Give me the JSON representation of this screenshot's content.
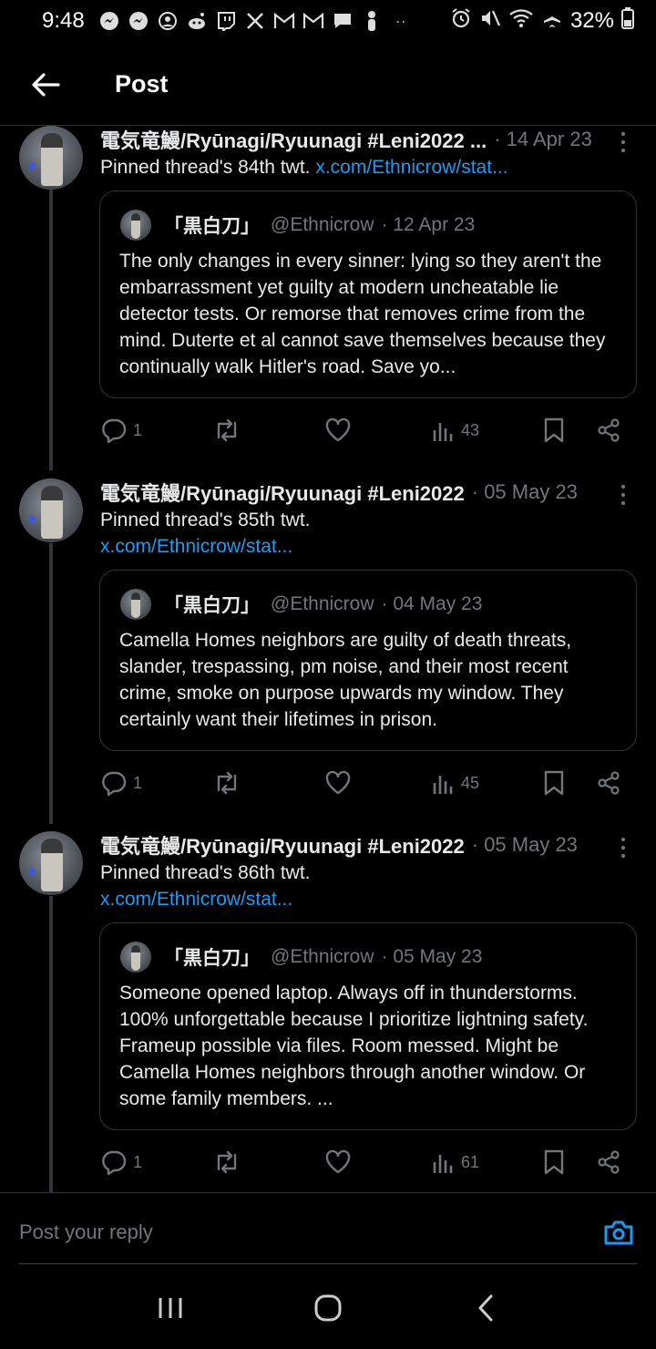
{
  "status_bar": {
    "time": "9:48",
    "battery": "32%",
    "left_icons": [
      "messenger-icon",
      "messenger-icon",
      "account-icon",
      "reddit-icon",
      "twitch-icon",
      "x-icon",
      "gmail-icon",
      "gmail-icon",
      "chat-icon",
      "person-icon",
      "more-dots-icon"
    ],
    "right_icons": [
      "alarm-icon",
      "mute-icon",
      "wifi-icon",
      "airplane-icon",
      "battery-icon"
    ]
  },
  "header": {
    "title": "Post"
  },
  "tweets": [
    {
      "name": "電気竜鰻/Ryūnagi/Ryuunagi #Leni2022",
      "name_truncated": "電気竜鰻/Ryūnagi/Ryuunagi #Leni2022 ...",
      "date": "· 14 Apr 23",
      "text": "Pinned thread's 84th twt.",
      "link": "x.com/Ethnicrow/stat...",
      "quote": {
        "name": "「黒白刀」",
        "handle": "@Ethnicrow",
        "date": "· 12 Apr 23",
        "text": "The only changes in every sinner: lying so they aren't the embarrassment yet guilty at modern uncheatable lie detector tests. Or remorse that removes crime from the mind. Duterte et al cannot save themselves because they continually walk Hitler's road. Save yo..."
      },
      "stats": {
        "replies": "1",
        "views": "43"
      }
    },
    {
      "name": "電気竜鰻/Ryūnagi/Ryuunagi #Leni2022",
      "date": "· 05 May 23",
      "text": "Pinned thread's 85th twt.",
      "link": "x.com/Ethnicrow/stat...",
      "quote": {
        "name": "「黒白刀」",
        "handle": "@Ethnicrow",
        "date": "· 04 May 23",
        "text": "Camella Homes neighbors are guilty of death threats, slander, trespassing, pm noise, and their most recent crime, smoke on purpose upwards my window. They certainly want their lifetimes in prison."
      },
      "stats": {
        "replies": "1",
        "views": "45"
      }
    },
    {
      "name": "電気竜鰻/Ryūnagi/Ryuunagi #Leni2022",
      "date": "· 05 May 23",
      "text": "Pinned thread's 86th twt.",
      "link": "x.com/Ethnicrow/stat...",
      "quote": {
        "name": "「黒白刀」",
        "handle": "@Ethnicrow",
        "date": "· 05 May 23",
        "text": "Someone opened laptop. Always off in thunderstorms. 100% unforgettable because I prioritize lightning safety. Frameup possible via files. Room messed. Might be Camella Homes neighbors through another window. Or some family members. ..."
      },
      "stats": {
        "replies": "1",
        "views": "61"
      }
    }
  ],
  "reply": {
    "placeholder": "Post your reply"
  },
  "colors": {
    "background": "#000000",
    "link": "#1d9bf0",
    "muted": "#71767b",
    "border": "#2f3336"
  }
}
